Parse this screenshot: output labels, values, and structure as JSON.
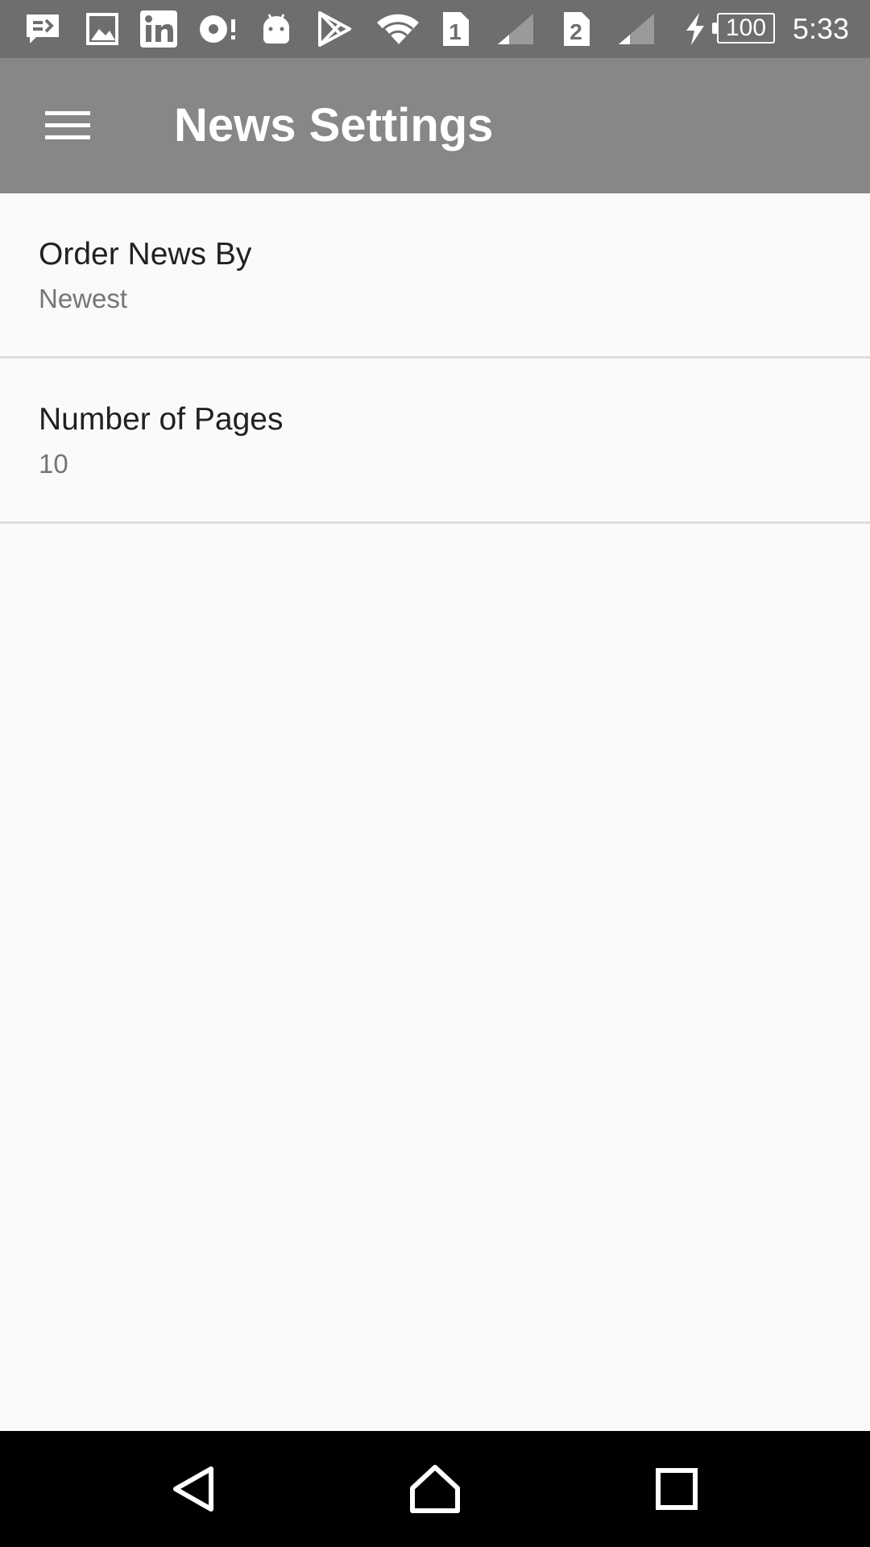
{
  "status_bar": {
    "icons": [
      "message-icon",
      "gallery-icon",
      "linkedin-icon",
      "record-icon",
      "android-icon",
      "play-store-icon",
      "wifi-icon",
      "sim-1-icon",
      "signal-1-icon",
      "sim-2-icon",
      "signal-2-icon",
      "charging-icon"
    ],
    "sim1_label": "1",
    "sim2_label": "2",
    "battery": "100",
    "time": "5:33"
  },
  "app_bar": {
    "title": "News Settings",
    "menu_icon": "hamburger-menu-icon",
    "background": "#878787"
  },
  "settings": [
    {
      "title": "Order News By",
      "summary": "Newest"
    },
    {
      "title": "Number of Pages",
      "summary": "10"
    }
  ],
  "nav_bar": {
    "icons": [
      "back-icon",
      "home-icon",
      "recents-icon"
    ]
  }
}
